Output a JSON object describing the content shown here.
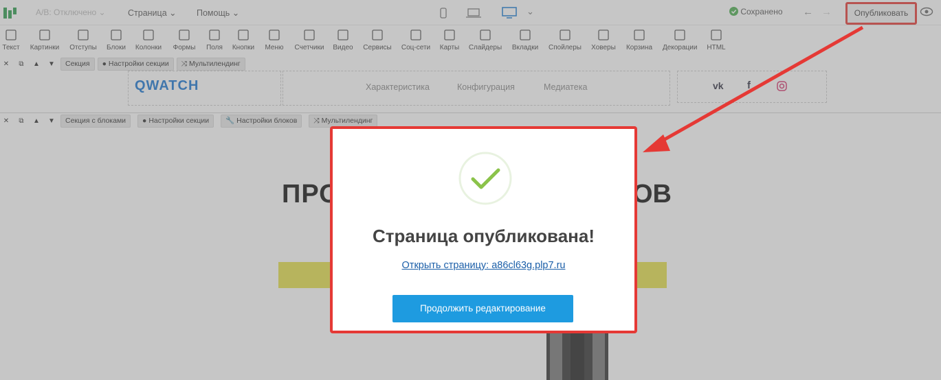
{
  "topbar": {
    "ab_test": "A/B: Отключено",
    "menu_page": "Страница",
    "menu_help": "Помощь",
    "saved_label": "Сохранено",
    "publish_label": "Опубликовать"
  },
  "tools": [
    {
      "label": "Текст",
      "icon": "text-icon"
    },
    {
      "label": "Картинки",
      "icon": "image-icon"
    },
    {
      "label": "Отступы",
      "icon": "spacing-icon"
    },
    {
      "label": "Блоки",
      "icon": "block-icon"
    },
    {
      "label": "Колонки",
      "icon": "columns-icon"
    },
    {
      "label": "Формы",
      "icon": "form-icon"
    },
    {
      "label": "Поля",
      "icon": "field-icon"
    },
    {
      "label": "Кнопки",
      "icon": "button-icon"
    },
    {
      "label": "Меню",
      "icon": "menu-icon"
    },
    {
      "label": "Счетчики",
      "icon": "counter-icon"
    },
    {
      "label": "Видео",
      "icon": "video-icon"
    },
    {
      "label": "Сервисы",
      "icon": "puzzle-icon"
    },
    {
      "label": "Соц-сети",
      "icon": "share-icon"
    },
    {
      "label": "Карты",
      "icon": "map-pin-icon"
    },
    {
      "label": "Слайдеры",
      "icon": "slider-icon"
    },
    {
      "label": "Вкладки",
      "icon": "tabs-icon"
    },
    {
      "label": "Спойлеры",
      "icon": "spoiler-icon"
    },
    {
      "label": "Ховеры",
      "icon": "hover-icon"
    },
    {
      "label": "Корзина",
      "icon": "cart-icon"
    },
    {
      "label": "Декорации",
      "icon": "decoration-icon"
    },
    {
      "label": "HTML",
      "icon": "code-icon"
    }
  ],
  "section1_bar": {
    "section": "Секция",
    "settings": "Настройки секции",
    "multi": "Мультилендинг"
  },
  "site_header": {
    "brand": "QWATCH",
    "nav": [
      "Характеристика",
      "Конфигурация",
      "Медиатека"
    ]
  },
  "section2_bar": {
    "section": "Секция с блоками",
    "settings": "Настройки секции",
    "block_settings": "Настройки блоков",
    "multi": "Мультилендинг"
  },
  "hero": {
    "left": "ПРО",
    "right": "ОВ"
  },
  "modal": {
    "title": "Страница опубликована!",
    "link": "Открыть страницу: a86cl63g.plp7.ru",
    "button": "Продолжить редактирование"
  },
  "colors": {
    "accent": "#1e9be0",
    "highlight": "#e53935",
    "success": "#8bc34a",
    "brand": "#1976d2"
  }
}
